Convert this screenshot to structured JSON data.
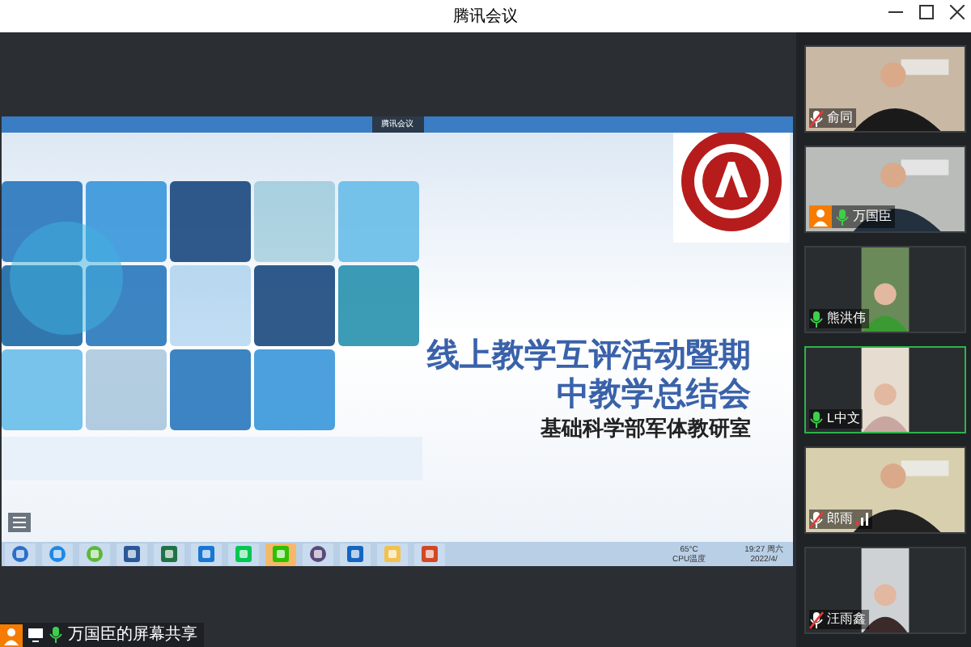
{
  "window": {
    "title": "腾讯会议"
  },
  "share": {
    "toolbar_label": "腾讯会议",
    "slide": {
      "title_lines": [
        "线上教学互评活动暨期",
        "中教学总结会"
      ],
      "subtitle": "基础科学部军体教研室"
    },
    "taskbar": {
      "apps": [
        {
          "kind": "start",
          "selected": false
        },
        {
          "kind": "ie",
          "selected": false
        },
        {
          "kind": "browser",
          "selected": false
        },
        {
          "kind": "word",
          "selected": false
        },
        {
          "kind": "excel",
          "selected": false
        },
        {
          "kind": "pdf",
          "selected": false
        },
        {
          "kind": "video",
          "selected": false
        },
        {
          "kind": "chat",
          "selected": true
        },
        {
          "kind": "media",
          "selected": false
        },
        {
          "kind": "meeting",
          "selected": false
        },
        {
          "kind": "folder",
          "selected": false
        },
        {
          "kind": "ppt",
          "selected": false
        }
      ],
      "tray": {
        "temperature": "65°C",
        "temperature_label": "CPU温度",
        "time": "19:27 周六",
        "date": "2022/4/"
      }
    }
  },
  "participants": [
    {
      "name": "俞同",
      "muted": true,
      "selected": false,
      "host": false,
      "signal": false
    },
    {
      "name": "万国臣",
      "muted": false,
      "selected": false,
      "host": true,
      "signal": false
    },
    {
      "name": "熊洪伟",
      "muted": false,
      "selected": false,
      "host": false,
      "signal": false
    },
    {
      "name": "L中文",
      "muted": false,
      "selected": true,
      "host": false,
      "signal": false
    },
    {
      "name": "郎雨",
      "muted": true,
      "selected": false,
      "host": false,
      "signal": true
    },
    {
      "name": "汪雨鑫",
      "muted": true,
      "selected": false,
      "host": false,
      "signal": false
    }
  ],
  "sharer_label": "万国臣的屏幕共享"
}
